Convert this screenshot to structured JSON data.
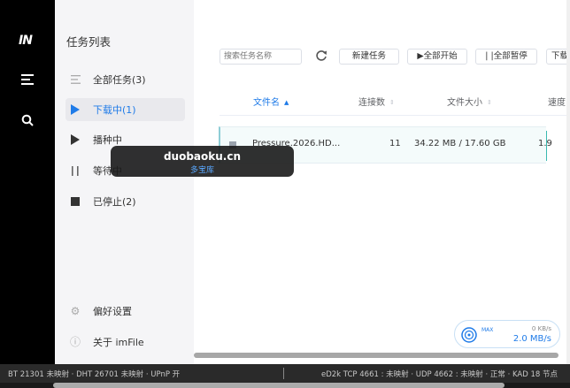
{
  "app": {
    "logo_text": "IN"
  },
  "sidebar": {
    "title": "任务列表",
    "categories": [
      {
        "label": "全部任务(3)",
        "icon": "list-icon"
      },
      {
        "label": "下载中(1)",
        "icon": "play-icon"
      },
      {
        "label": "播种中",
        "icon": "play-icon"
      },
      {
        "label": "等待中",
        "icon": "pause-icon"
      },
      {
        "label": "已停止(2)",
        "icon": "stop-icon"
      }
    ],
    "active_index": 1,
    "preferences": "偏好设置",
    "about": "关于 imFile"
  },
  "toolbar": {
    "search_placeholder": "搜索任务名称",
    "new_task": "新建任务",
    "start_all": "▶全部开始",
    "pause_all": "| |全部暂停",
    "download": "下载"
  },
  "table": {
    "columns": [
      "文件名",
      "连接数",
      "文件大小",
      "速度"
    ],
    "rows": [
      {
        "name": "Pressure.2026.HD...",
        "connections": "11",
        "size": "34.22 MB / 17.60 GB",
        "speed": "1.9"
      }
    ]
  },
  "speed": {
    "max_label": "MAX",
    "upload": "0 KB/s",
    "download": "2.0 MB/s"
  },
  "status": {
    "left": "BT 21301 未映射 · DHT 26701 未映射 · UPnP 开",
    "right": "eD2k TCP 4661 : 未映射 · UDP 4662 : 未映射 · 正常 · KAD 18 节点"
  },
  "watermark": {
    "domain": "duobaoku.cn",
    "sub": "多宝库"
  },
  "colors": {
    "accent": "#1f7be8",
    "rail": "#000000",
    "sidebar_bg": "#f5f5f7",
    "status_bg": "#2a2a2a"
  }
}
